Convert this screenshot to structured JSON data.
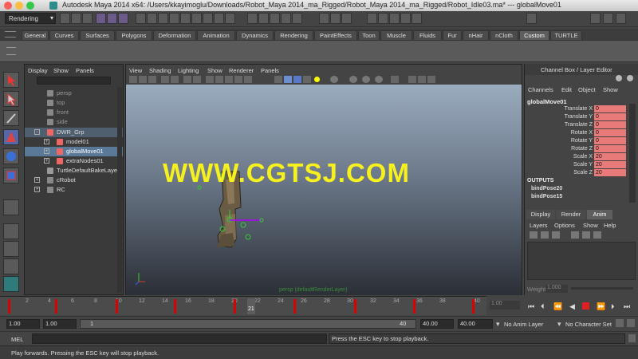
{
  "window": {
    "title": "Autodesk Maya 2014 x64: /Users/kkayimoglu/Downloads/Robot_Maya 2014_ma_Rigged/Robot_Maya 2014_ma_Rigged/Robot_Idle03.ma*   ---   globalMove01"
  },
  "statusline": {
    "mode": "Rendering"
  },
  "shelf": {
    "tabs": [
      "General",
      "Curves",
      "Surfaces",
      "Polygons",
      "Deformation",
      "Animation",
      "Dynamics",
      "Rendering",
      "PaintEffects",
      "Toon",
      "Muscle",
      "Fluids",
      "Fur",
      "nHair",
      "nCloth",
      "Custom",
      "TURTLE"
    ],
    "active": "Custom"
  },
  "outliner": {
    "menu": [
      "Display",
      "Show",
      "Panels"
    ],
    "items": [
      {
        "label": "persp"
      },
      {
        "label": "top"
      },
      {
        "label": "front"
      },
      {
        "label": "side"
      },
      {
        "label": "DWR_Grp"
      },
      {
        "label": "model01"
      },
      {
        "label": "globalMove01"
      },
      {
        "label": "extraNodes01"
      },
      {
        "label": "TurtleDefaultBakeLayer"
      },
      {
        "label": "cRobot"
      },
      {
        "label": "RC"
      }
    ]
  },
  "viewport": {
    "menu": [
      "View",
      "Shading",
      "Lighting",
      "Show",
      "Renderer",
      "Panels"
    ],
    "watermark": "WWW.CGTSJ.COM",
    "camera_label": "persp (defaultRenderLayer)"
  },
  "channelbox": {
    "title": "Channel Box / Layer Editor",
    "menu": [
      "Channels",
      "Edit",
      "Object",
      "Show"
    ],
    "object": "globalMove01",
    "channels": [
      {
        "name": "Translate X",
        "value": "0"
      },
      {
        "name": "Translate Y",
        "value": "0"
      },
      {
        "name": "Translate Z",
        "value": "0"
      },
      {
        "name": "Rotate X",
        "value": "0"
      },
      {
        "name": "Rotate Y",
        "value": "0"
      },
      {
        "name": "Rotate Z",
        "value": "0"
      },
      {
        "name": "Scale X",
        "value": "20"
      },
      {
        "name": "Scale Y",
        "value": "20"
      },
      {
        "name": "Scale Z",
        "value": "20"
      }
    ],
    "outputs_label": "OUTPUTS",
    "outputs": [
      "bindPose20",
      "bindPose15"
    ],
    "layer_tabs": [
      "Display",
      "Render",
      "Anim"
    ],
    "layer_tab_active": "Anim",
    "layer_menu": [
      "Layers",
      "Options",
      "Show",
      "Help"
    ],
    "weight_label": "Weight",
    "weight_value": "1.000"
  },
  "timeline": {
    "ticks": [
      "2",
      "4",
      "6",
      "8",
      "10",
      "12",
      "14",
      "16",
      "18",
      "20",
      "22",
      "24",
      "26",
      "28",
      "30",
      "32",
      "34",
      "36",
      "38",
      "40"
    ],
    "current_frame": "21",
    "current_time_field": "1.00"
  },
  "range": {
    "start": "1.00",
    "playback_start": "1.00",
    "slider_start": "1",
    "slider_end": "40",
    "playback_end": "40.00",
    "end": "40.00",
    "anim_layer": "No Anim Layer",
    "character_set": "No Character Set"
  },
  "cmdline": {
    "label": "MEL",
    "feedback": "Press the ESC key to stop playback."
  },
  "helpline": {
    "text": "Play forwards. Pressing the ESC key will stop playback."
  }
}
